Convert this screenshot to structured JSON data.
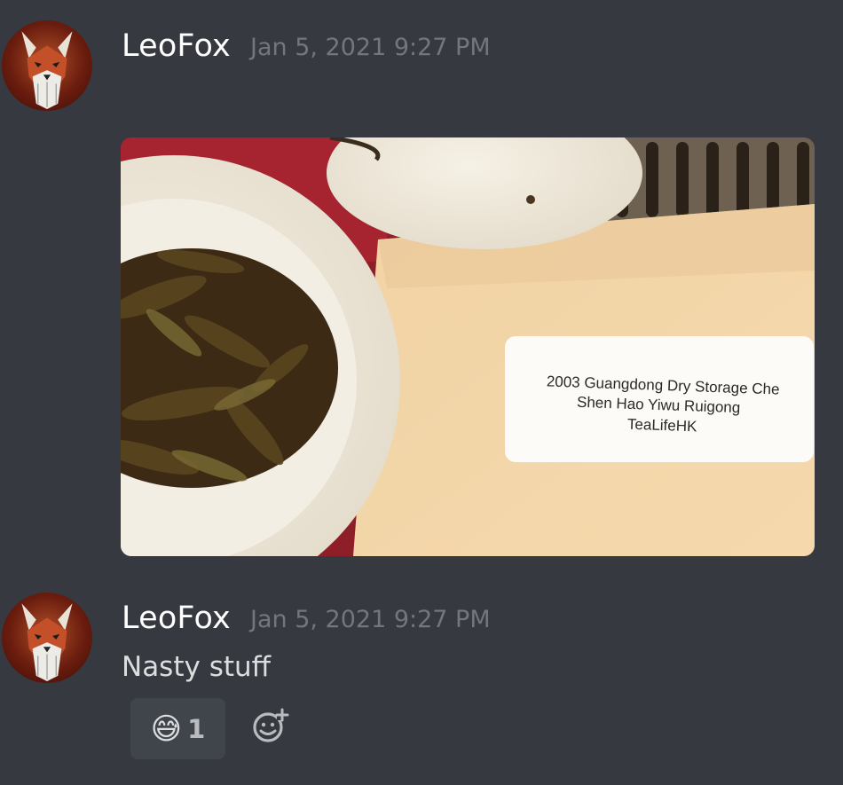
{
  "messages": [
    {
      "author": "LeoFox",
      "timestamp": "Jan 5, 2021 9:27 PM",
      "attachment": {
        "label_lines": [
          "2003 Guangdong Dry Storage Che",
          "Shen Hao Yiwu Ruigong",
          "TeaLifeHK"
        ]
      }
    },
    {
      "author": "LeoFox",
      "timestamp": "Jan 5, 2021 9:27 PM",
      "text": "Nasty stuff",
      "reactions": [
        {
          "emoji": "😅",
          "count": "1"
        }
      ]
    }
  ],
  "icons": {
    "avatar": "fox-avatar-icon",
    "add_reaction": "add-reaction-icon"
  },
  "colors": {
    "background": "#36393f",
    "username": "#ffffff",
    "timestamp": "#72767d",
    "reaction_bg": "#40444b"
  }
}
